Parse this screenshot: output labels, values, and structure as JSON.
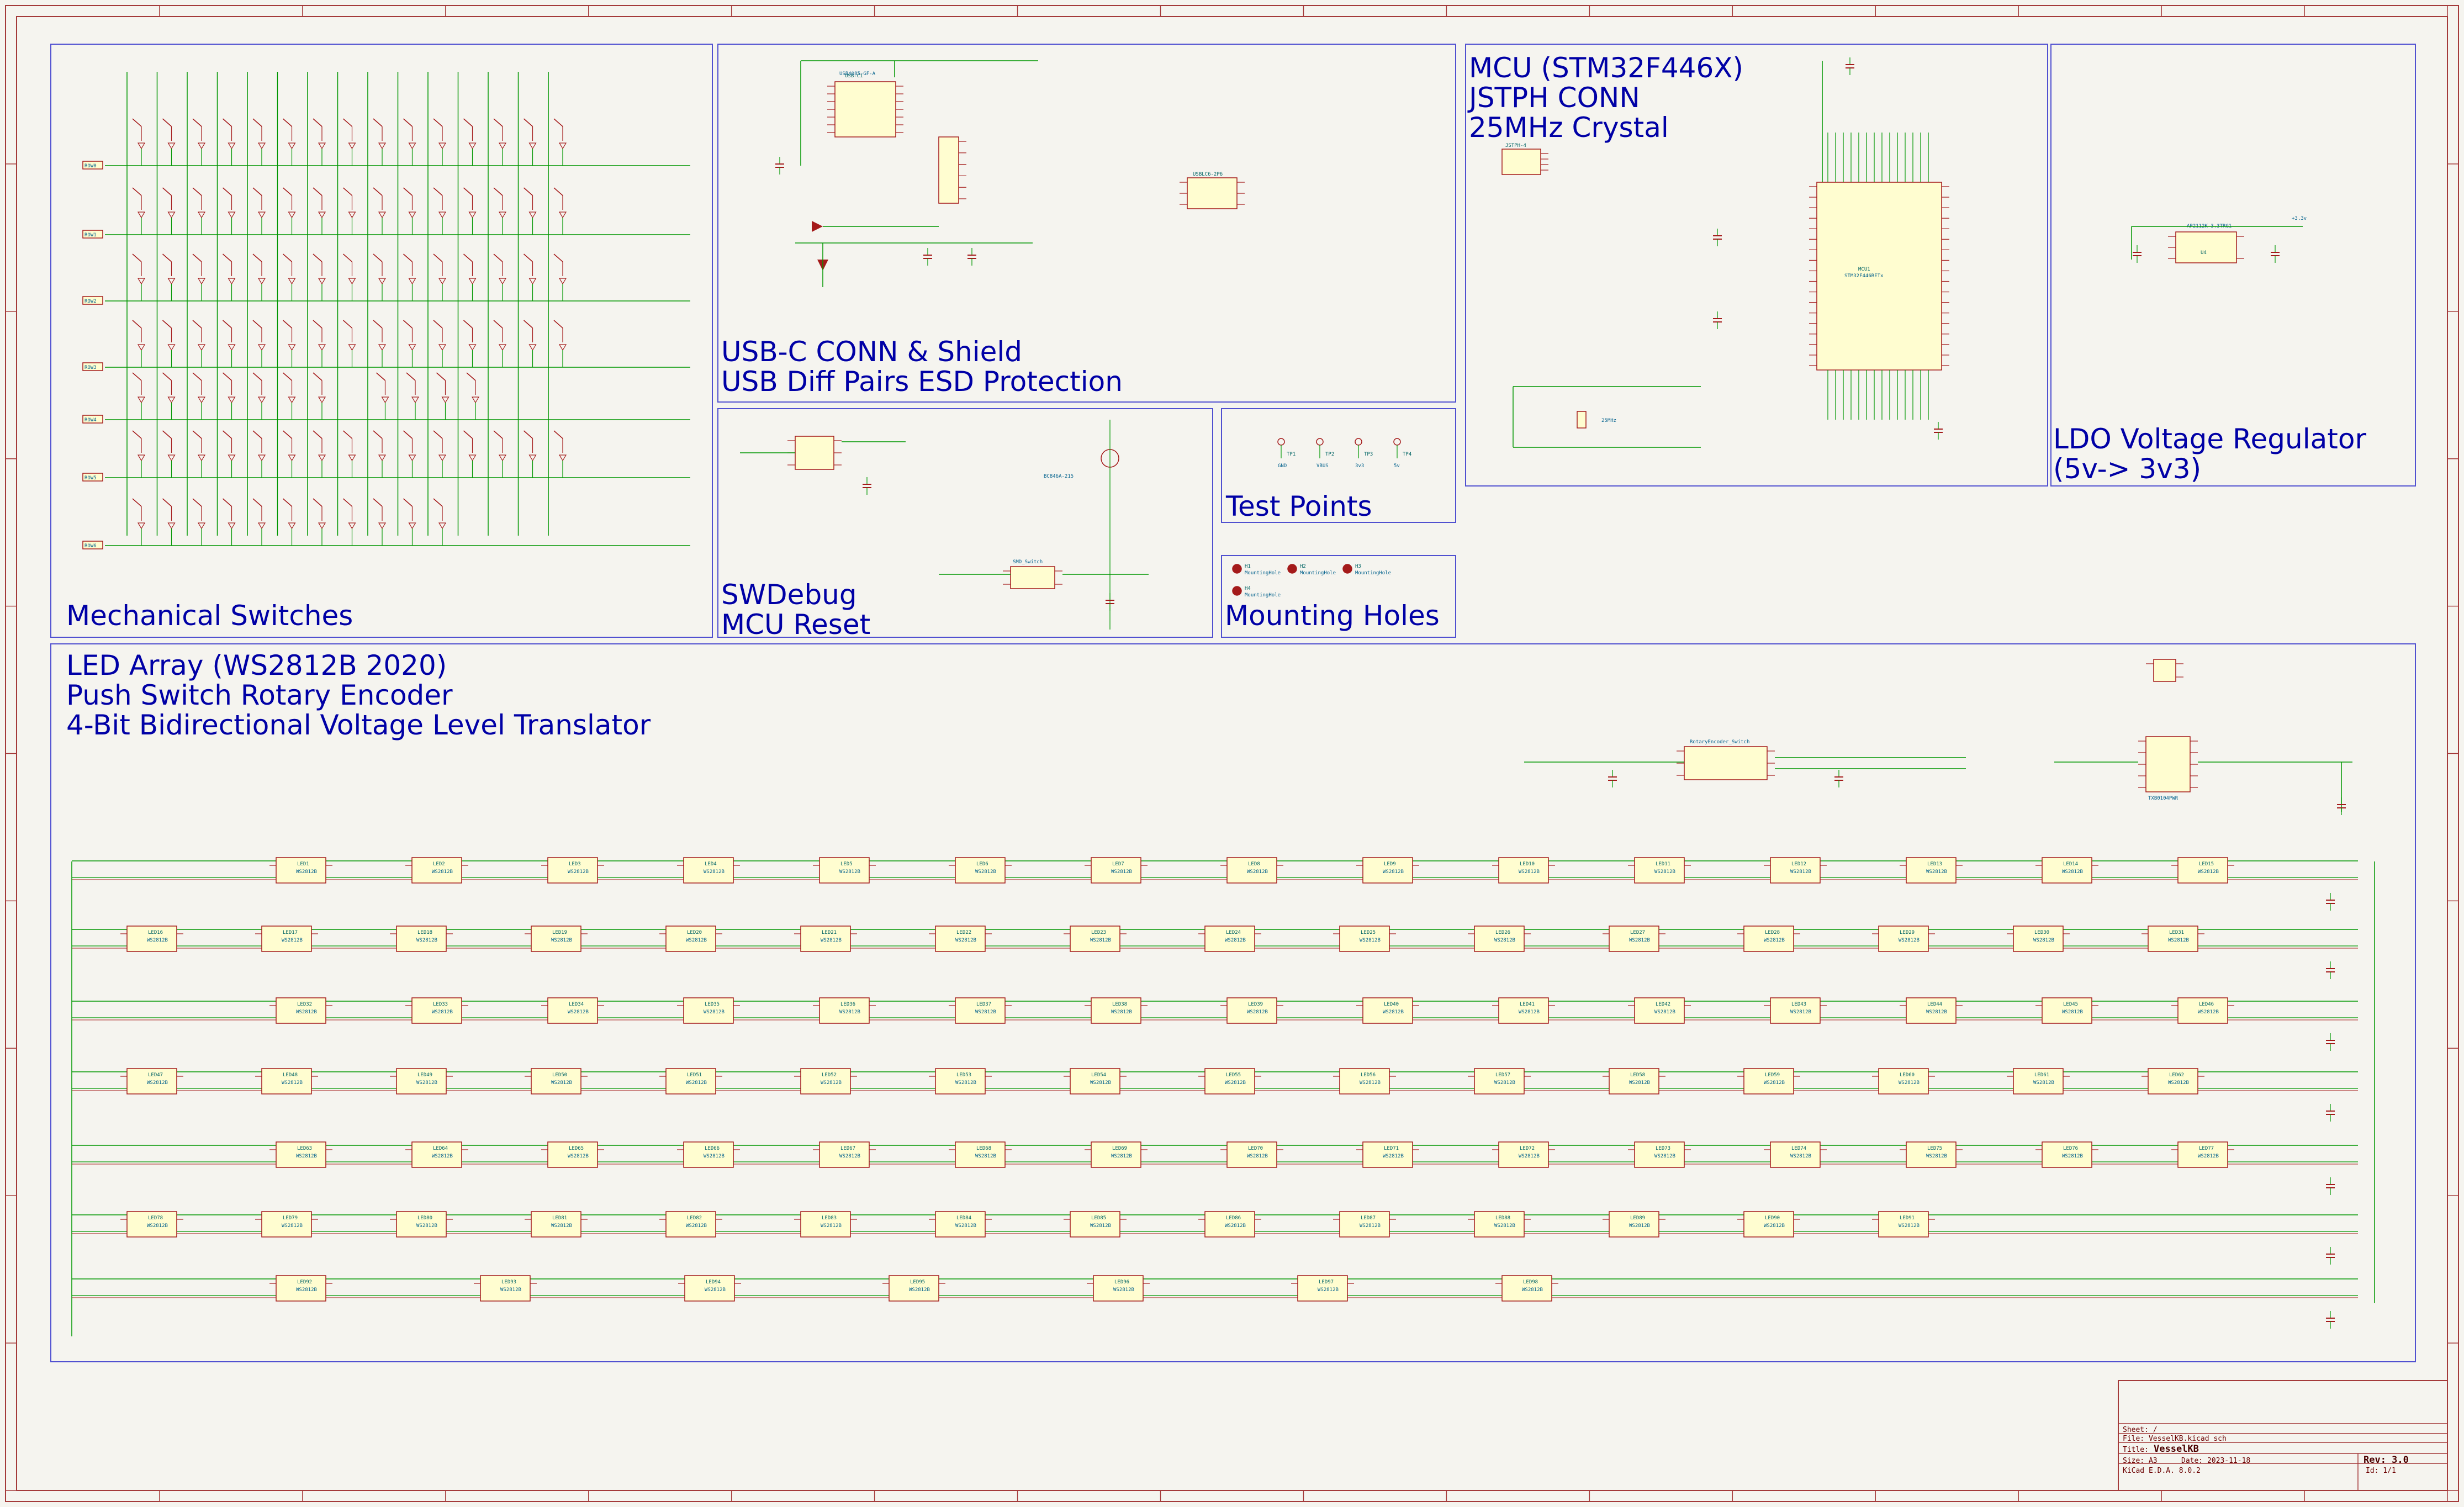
{
  "blocks": {
    "switches": "Mechanical Switches",
    "usb": "USB-C CONN & Shield\nUSB Diff Pairs ESD Protection",
    "mcu": "MCU (STM32F446X)\nJSTPH CONN\n25MHz Crystal",
    "ldo": "LDO Voltage Regulator\n(5v-> 3v3)",
    "swd": "SWDebug\nMCU Reset",
    "testpoints": "Test Points",
    "holes": "Mounting Holes",
    "led": "LED Array (WS2812B 2020)\nPush Switch Rotary Encoder\n4-Bit Bidirectional Voltage Level Translator"
  },
  "labels": {
    "rows": [
      "ROW0",
      "ROW1",
      "ROW2",
      "ROW3",
      "ROW4",
      "ROW5",
      "ROW6"
    ],
    "led_part": "WS2812B",
    "led_prefix": "LED",
    "mcu_ref": "MCU1",
    "mcu_part": "STM32F446RETx",
    "crystal": "25MHz",
    "ldo_ref": "U4",
    "ldo_part": "AP2112K-3.3TRG1",
    "usb_ref": "USB-C1",
    "usb_part": "USB4085-GF-A",
    "esd_ref": "USBLC6-2P6",
    "jst_ref": "JSTPH-4",
    "level_shifter": "TXB0104PWR",
    "encoder": "RotaryEncoder_Switch",
    "reset_part": "SMD_Switch",
    "mosfet": "BC846A-215",
    "test_points": [
      "TP1",
      "TP2",
      "TP3",
      "TP4"
    ],
    "tp_nets": [
      "GND",
      "VBUS",
      "3v3",
      "5v"
    ],
    "holes": [
      "H1",
      "H2",
      "H3",
      "H4"
    ],
    "hole_label": "MountingHole",
    "pwr_flag": "PWR_FLAG",
    "gnd": "GND",
    "plus5v": "+5v",
    "plus3v3": "+3.3v"
  },
  "title_block": {
    "sheet_label": "Sheet: /",
    "file": "File: VesselKB.kicad_sch",
    "title_label": "Title:",
    "title": "VesselKB",
    "size_label": "Size: A3",
    "date": "Date: 2023-11-18",
    "rev_label": "Rev: 3.0",
    "tool": "KiCad E.D.A. 8.0.2",
    "id": "Id: 1/1"
  },
  "colors": {
    "background": "#f5f4ef",
    "border": "#a43a3a",
    "block_outline": "#3a3ad0",
    "wire": "#009600",
    "component": "#a41a1a",
    "component_fill": "#fffdd0",
    "label_text": "#0000a6",
    "net_label": "#a41a1a"
  }
}
